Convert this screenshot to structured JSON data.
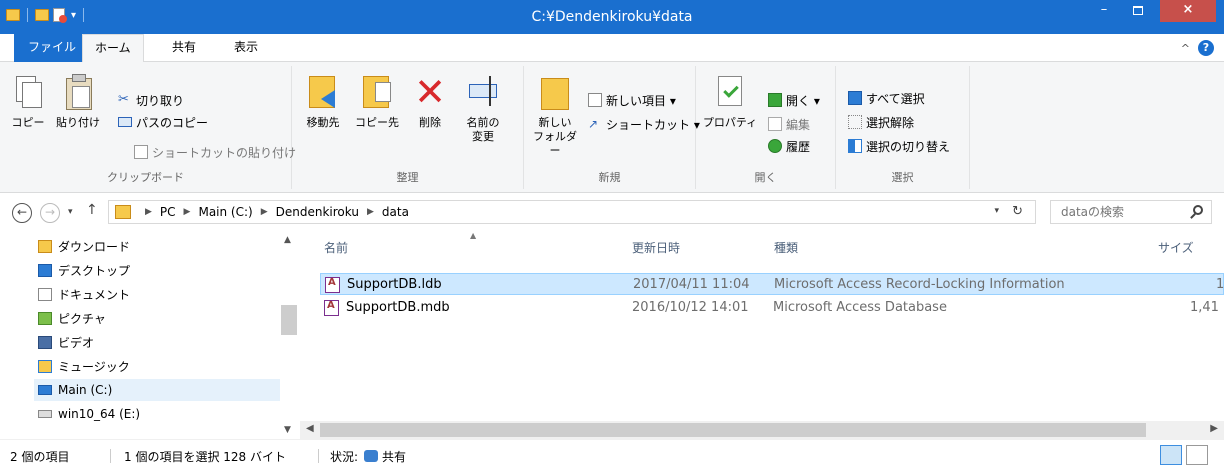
{
  "window": {
    "title": "C:¥Dendenkiroku¥data",
    "minimize": "–",
    "close": "×"
  },
  "tabs": {
    "file": "ファイル",
    "home": "ホーム",
    "share": "共有",
    "view": "表示"
  },
  "ribbon_right": {
    "collapse": "^",
    "help": "?"
  },
  "clipboard": {
    "copy": "コピー",
    "paste": "貼り付け",
    "cut": "切り取り",
    "copy_path": "パスのコピー",
    "paste_shortcut": "ショートカットの貼り付け",
    "label": "クリップボード"
  },
  "organize": {
    "move_to": "移動先",
    "copy_to": "コピー先",
    "delete": "削除",
    "rename_1": "名前の",
    "rename_2": "変更",
    "label": "整理"
  },
  "new": {
    "new_folder_1": "新しい",
    "new_folder_2": "フォルダー",
    "new_item": "新しい項目 ▾",
    "shortcut": "ショートカット ▾",
    "label": "新規"
  },
  "open": {
    "properties": "プロパティ",
    "open": "開く ▾",
    "edit": "編集",
    "history": "履歴",
    "label": "開く"
  },
  "select": {
    "select_all": "すべて選択",
    "select_none": "選択解除",
    "invert": "選択の切り替え",
    "label": "選択"
  },
  "address": {
    "back": "←",
    "forward": "→",
    "recent": "▾",
    "up": "↑",
    "crumbs": [
      "PC",
      "Main (C:)",
      "Dendenkiroku",
      "data"
    ],
    "search_placeholder": "dataの検索"
  },
  "nav_pane": {
    "items": [
      {
        "label": "ダウンロード"
      },
      {
        "label": "デスクトップ"
      },
      {
        "label": "ドキュメント"
      },
      {
        "label": "ピクチャ"
      },
      {
        "label": "ビデオ"
      },
      {
        "label": "ミュージック"
      },
      {
        "label": "Main (C:)"
      },
      {
        "label": "win10_64 (E:)"
      }
    ]
  },
  "columns": {
    "name": "名前",
    "date": "更新日時",
    "type": "種類",
    "size": "サイズ"
  },
  "files": [
    {
      "name": "SupportDB.ldb",
      "date": "2017/04/11 11:04",
      "type": "Microsoft Access Record-Locking Information",
      "size": "1"
    },
    {
      "name": "SupportDB.mdb",
      "date": "2016/10/12 14:01",
      "type": "Microsoft Access Database",
      "size": "1,41"
    }
  ],
  "status": {
    "count": "2 個の項目",
    "selected": "1 個の項目を選択 128 バイト",
    "state": "状況:",
    "shared": "共有"
  },
  "colors": {
    "titlebar": "#1a6fcf",
    "close": "#c7504b",
    "selection": "#cde8ff"
  }
}
